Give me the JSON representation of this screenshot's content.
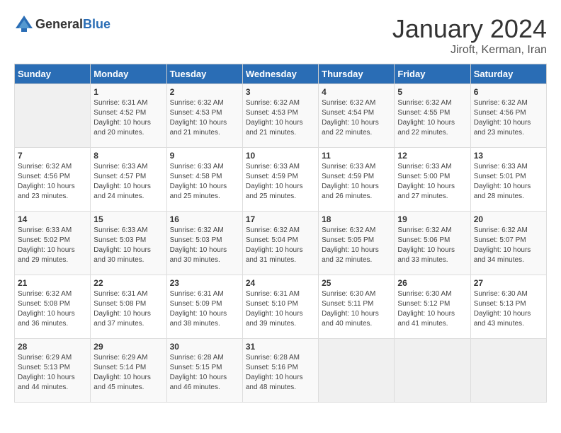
{
  "header": {
    "logo_general": "General",
    "logo_blue": "Blue",
    "title": "January 2024",
    "subtitle": "Jiroft, Kerman, Iran"
  },
  "weekdays": [
    "Sunday",
    "Monday",
    "Tuesday",
    "Wednesday",
    "Thursday",
    "Friday",
    "Saturday"
  ],
  "weeks": [
    [
      {
        "day": "",
        "sunrise": "",
        "sunset": "",
        "daylight": ""
      },
      {
        "day": "1",
        "sunrise": "Sunrise: 6:31 AM",
        "sunset": "Sunset: 4:52 PM",
        "daylight": "Daylight: 10 hours and 20 minutes."
      },
      {
        "day": "2",
        "sunrise": "Sunrise: 6:32 AM",
        "sunset": "Sunset: 4:53 PM",
        "daylight": "Daylight: 10 hours and 21 minutes."
      },
      {
        "day": "3",
        "sunrise": "Sunrise: 6:32 AM",
        "sunset": "Sunset: 4:53 PM",
        "daylight": "Daylight: 10 hours and 21 minutes."
      },
      {
        "day": "4",
        "sunrise": "Sunrise: 6:32 AM",
        "sunset": "Sunset: 4:54 PM",
        "daylight": "Daylight: 10 hours and 22 minutes."
      },
      {
        "day": "5",
        "sunrise": "Sunrise: 6:32 AM",
        "sunset": "Sunset: 4:55 PM",
        "daylight": "Daylight: 10 hours and 22 minutes."
      },
      {
        "day": "6",
        "sunrise": "Sunrise: 6:32 AM",
        "sunset": "Sunset: 4:56 PM",
        "daylight": "Daylight: 10 hours and 23 minutes."
      }
    ],
    [
      {
        "day": "7",
        "sunrise": "Sunrise: 6:32 AM",
        "sunset": "Sunset: 4:56 PM",
        "daylight": "Daylight: 10 hours and 23 minutes."
      },
      {
        "day": "8",
        "sunrise": "Sunrise: 6:33 AM",
        "sunset": "Sunset: 4:57 PM",
        "daylight": "Daylight: 10 hours and 24 minutes."
      },
      {
        "day": "9",
        "sunrise": "Sunrise: 6:33 AM",
        "sunset": "Sunset: 4:58 PM",
        "daylight": "Daylight: 10 hours and 25 minutes."
      },
      {
        "day": "10",
        "sunrise": "Sunrise: 6:33 AM",
        "sunset": "Sunset: 4:59 PM",
        "daylight": "Daylight: 10 hours and 25 minutes."
      },
      {
        "day": "11",
        "sunrise": "Sunrise: 6:33 AM",
        "sunset": "Sunset: 4:59 PM",
        "daylight": "Daylight: 10 hours and 26 minutes."
      },
      {
        "day": "12",
        "sunrise": "Sunrise: 6:33 AM",
        "sunset": "Sunset: 5:00 PM",
        "daylight": "Daylight: 10 hours and 27 minutes."
      },
      {
        "day": "13",
        "sunrise": "Sunrise: 6:33 AM",
        "sunset": "Sunset: 5:01 PM",
        "daylight": "Daylight: 10 hours and 28 minutes."
      }
    ],
    [
      {
        "day": "14",
        "sunrise": "Sunrise: 6:33 AM",
        "sunset": "Sunset: 5:02 PM",
        "daylight": "Daylight: 10 hours and 29 minutes."
      },
      {
        "day": "15",
        "sunrise": "Sunrise: 6:33 AM",
        "sunset": "Sunset: 5:03 PM",
        "daylight": "Daylight: 10 hours and 30 minutes."
      },
      {
        "day": "16",
        "sunrise": "Sunrise: 6:32 AM",
        "sunset": "Sunset: 5:03 PM",
        "daylight": "Daylight: 10 hours and 30 minutes."
      },
      {
        "day": "17",
        "sunrise": "Sunrise: 6:32 AM",
        "sunset": "Sunset: 5:04 PM",
        "daylight": "Daylight: 10 hours and 31 minutes."
      },
      {
        "day": "18",
        "sunrise": "Sunrise: 6:32 AM",
        "sunset": "Sunset: 5:05 PM",
        "daylight": "Daylight: 10 hours and 32 minutes."
      },
      {
        "day": "19",
        "sunrise": "Sunrise: 6:32 AM",
        "sunset": "Sunset: 5:06 PM",
        "daylight": "Daylight: 10 hours and 33 minutes."
      },
      {
        "day": "20",
        "sunrise": "Sunrise: 6:32 AM",
        "sunset": "Sunset: 5:07 PM",
        "daylight": "Daylight: 10 hours and 34 minutes."
      }
    ],
    [
      {
        "day": "21",
        "sunrise": "Sunrise: 6:32 AM",
        "sunset": "Sunset: 5:08 PM",
        "daylight": "Daylight: 10 hours and 36 minutes."
      },
      {
        "day": "22",
        "sunrise": "Sunrise: 6:31 AM",
        "sunset": "Sunset: 5:08 PM",
        "daylight": "Daylight: 10 hours and 37 minutes."
      },
      {
        "day": "23",
        "sunrise": "Sunrise: 6:31 AM",
        "sunset": "Sunset: 5:09 PM",
        "daylight": "Daylight: 10 hours and 38 minutes."
      },
      {
        "day": "24",
        "sunrise": "Sunrise: 6:31 AM",
        "sunset": "Sunset: 5:10 PM",
        "daylight": "Daylight: 10 hours and 39 minutes."
      },
      {
        "day": "25",
        "sunrise": "Sunrise: 6:30 AM",
        "sunset": "Sunset: 5:11 PM",
        "daylight": "Daylight: 10 hours and 40 minutes."
      },
      {
        "day": "26",
        "sunrise": "Sunrise: 6:30 AM",
        "sunset": "Sunset: 5:12 PM",
        "daylight": "Daylight: 10 hours and 41 minutes."
      },
      {
        "day": "27",
        "sunrise": "Sunrise: 6:30 AM",
        "sunset": "Sunset: 5:13 PM",
        "daylight": "Daylight: 10 hours and 43 minutes."
      }
    ],
    [
      {
        "day": "28",
        "sunrise": "Sunrise: 6:29 AM",
        "sunset": "Sunset: 5:13 PM",
        "daylight": "Daylight: 10 hours and 44 minutes."
      },
      {
        "day": "29",
        "sunrise": "Sunrise: 6:29 AM",
        "sunset": "Sunset: 5:14 PM",
        "daylight": "Daylight: 10 hours and 45 minutes."
      },
      {
        "day": "30",
        "sunrise": "Sunrise: 6:28 AM",
        "sunset": "Sunset: 5:15 PM",
        "daylight": "Daylight: 10 hours and 46 minutes."
      },
      {
        "day": "31",
        "sunrise": "Sunrise: 6:28 AM",
        "sunset": "Sunset: 5:16 PM",
        "daylight": "Daylight: 10 hours and 48 minutes."
      },
      {
        "day": "",
        "sunrise": "",
        "sunset": "",
        "daylight": ""
      },
      {
        "day": "",
        "sunrise": "",
        "sunset": "",
        "daylight": ""
      },
      {
        "day": "",
        "sunrise": "",
        "sunset": "",
        "daylight": ""
      }
    ]
  ]
}
